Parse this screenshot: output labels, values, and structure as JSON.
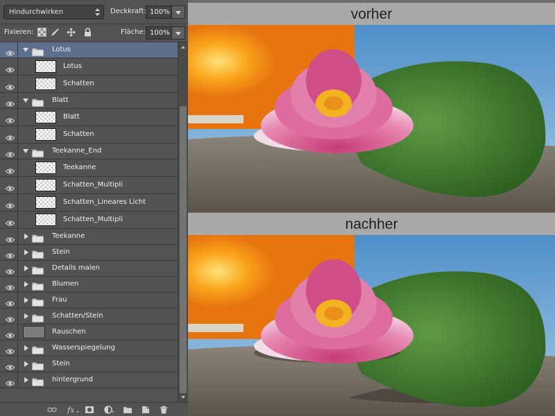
{
  "layers_panel": {
    "blend_mode": "Hindurchwirken",
    "opacity_label": "Deckkraft:",
    "opacity_value": "100%",
    "lock_label": "Fixieren:",
    "fill_label": "Fläche:",
    "fill_value": "100%",
    "layers": [
      {
        "name": "Lotus",
        "type": "group",
        "expanded": true,
        "selected": true
      },
      {
        "name": "Lotus",
        "type": "layer",
        "indent": true
      },
      {
        "name": "Schatten",
        "type": "layer",
        "indent": true
      },
      {
        "name": "Blatt",
        "type": "group",
        "expanded": true
      },
      {
        "name": "Blatt",
        "type": "layer",
        "indent": true
      },
      {
        "name": "Schatten",
        "type": "layer",
        "indent": true
      },
      {
        "name": "Teekanne_End",
        "type": "group",
        "expanded": true
      },
      {
        "name": "Teekanne",
        "type": "layer",
        "indent": true
      },
      {
        "name": "Schatten_Multipli",
        "type": "layer",
        "indent": true
      },
      {
        "name": "Schatten_Lineares Licht",
        "type": "layer",
        "indent": true
      },
      {
        "name": "Schatten_Multipli",
        "type": "layer",
        "indent": true
      },
      {
        "name": "Teekanne",
        "type": "group",
        "expanded": false
      },
      {
        "name": "Stein",
        "type": "group",
        "expanded": false
      },
      {
        "name": "Details malen",
        "type": "group",
        "expanded": false
      },
      {
        "name": "Blumen",
        "type": "group",
        "expanded": false
      },
      {
        "name": "Frau",
        "type": "group",
        "expanded": false
      },
      {
        "name": "Schatten/Stein",
        "type": "group",
        "expanded": false
      },
      {
        "name": "Rauschen",
        "type": "fill"
      },
      {
        "name": "Wasserspiegelung",
        "type": "group",
        "expanded": false
      },
      {
        "name": "Stein",
        "type": "group",
        "expanded": false
      },
      {
        "name": "hintergrund",
        "type": "group",
        "expanded": false
      }
    ],
    "bottom_icons": [
      "link-layers-icon",
      "fx-icon",
      "add-mask-icon",
      "adjustment-layer-icon",
      "new-group-icon",
      "new-layer-icon",
      "delete-layer-icon"
    ]
  },
  "preview": {
    "before_label": "vorher",
    "after_label": "nachher"
  }
}
